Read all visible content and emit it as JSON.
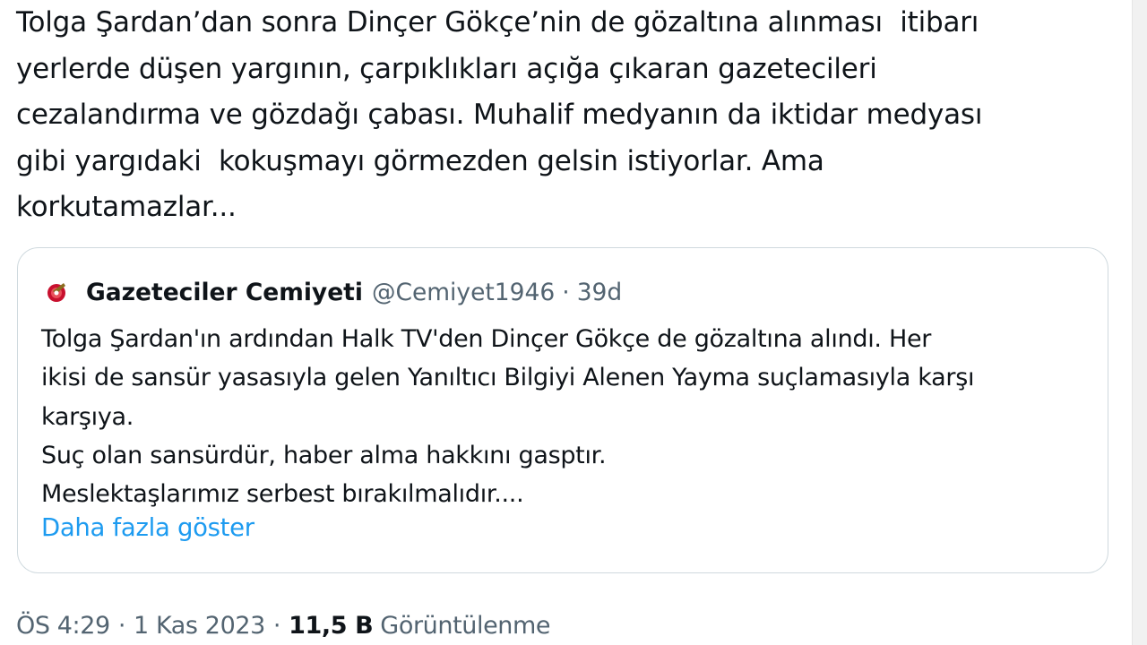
{
  "tweet": {
    "text": "Tolga Şardan’dan sonra Dinçer Gökçe’nin de gözaltına alınması  itibarı\nyerlerde düşen yargının, çarpıklıkları açığa çıkaran gazetecileri\ncezalandırma ve gözdağı çabası. Muhalif medyanın da iktidar medyası\ngibi yargıdaki  kokuşmayı görmezden gelsin istiyorlar. Ama\nkorkutamazlar..."
  },
  "quoted_tweet": {
    "avatar_icon": "gazeteciler-cemiyeti-logo-icon",
    "author_name": "Gazeteciler Cemiyeti",
    "handle": "@Cemiyet1946",
    "separator": "·",
    "time": "39d",
    "text": "Tolga Şardan'ın ardından Halk TV'den Dinçer Gökçe de gözaltına alındı. Her\nikisi de sansür yasasıyla gelen Yanıltıcı Bilgiyi Alenen Yayma suçlamasıyla karşı\nkarşıya.\nSuç olan sansürdür, haber alma hakkını gasptır.\nMeslektaşlarımız serbest bırakılmalıdır....",
    "show_more": "Daha fazla göster"
  },
  "meta": {
    "time": "ÖS 4:29",
    "separator": "·",
    "date": "1 Kas 2023",
    "views_count": "11,5 B",
    "views_label": "Görüntülenme"
  },
  "colors": {
    "text": "#0f1419",
    "secondary": "#536471",
    "link": "#1d9bf0",
    "border": "#cfd9de",
    "logo_red": "#c8102e"
  }
}
